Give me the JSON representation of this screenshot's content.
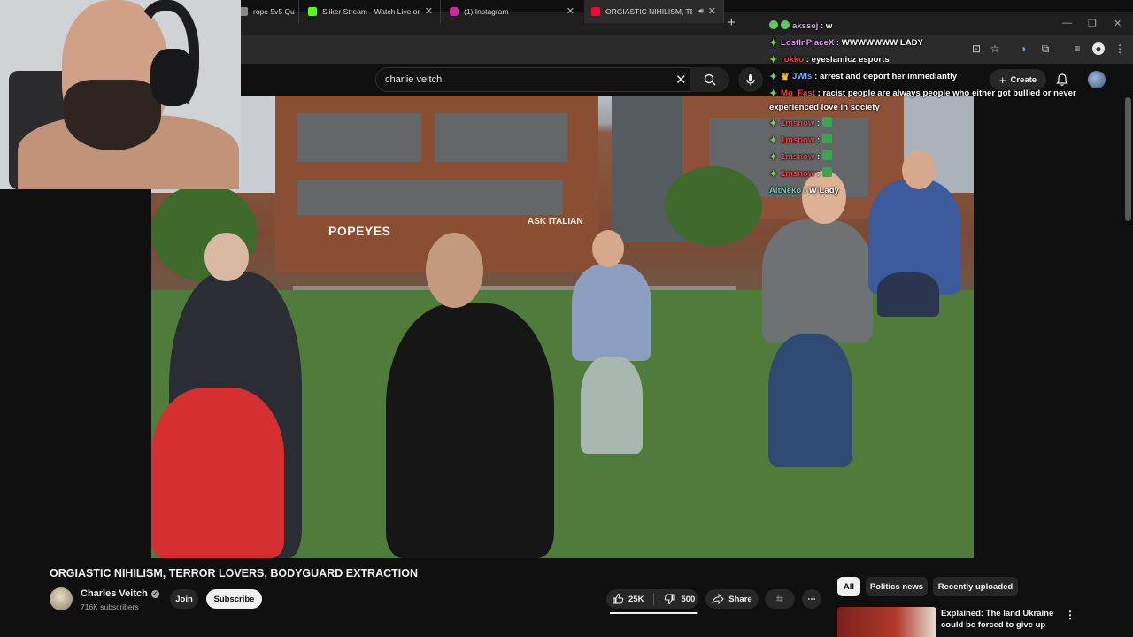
{
  "browser": {
    "tabs": [
      {
        "label": "rope 5v5 Qu",
        "icon": "generic-favicon",
        "color": "#888888"
      },
      {
        "label": "Sliker Stream - Watch Live on K",
        "icon": "kick-favicon",
        "color": "#53fc18"
      },
      {
        "label": "(1) Instagram",
        "icon": "instagram-favicon",
        "color": "#d6249f"
      },
      {
        "label": "ORGIASTIC NIHILISM, TERR",
        "icon": "youtube-favicon",
        "color": "#ff0033"
      }
    ]
  },
  "youtube": {
    "search_query": "charlie veitch",
    "create_label": "Create"
  },
  "chat": [
    {
      "user": "akssej",
      "user_color": "#d6a0e6",
      "message": "w",
      "badge": "circle"
    },
    {
      "user": "LostInPlaceX",
      "user_color": "#d6a0e6",
      "message": "WWWWWWW LADY",
      "badge": "sparkle"
    },
    {
      "user": "rokko",
      "user_color": "#ff3b3b",
      "message": "eyeslamicz esports",
      "badge": "sparkle"
    },
    {
      "user": "JWls",
      "user_color": "#7aa7ff",
      "message": "arrest and deport her immediantly",
      "badge": "crown"
    },
    {
      "user": "Mo_Fast",
      "user_color": "#ff3b3b",
      "message": "racist people are always people who either got bullied or never experienced love in society",
      "badge": "sparkle"
    },
    {
      "user": "1msnow",
      "user_color": "#ff3b3b",
      "message": "",
      "badge": "sparkle",
      "emote": true
    },
    {
      "user": "1msnow",
      "user_color": "#ff3b3b",
      "message": "",
      "badge": "sparkle",
      "emote": true
    },
    {
      "user": "1msnow",
      "user_color": "#ff3b3b",
      "message": "",
      "badge": "sparkle",
      "emote": true
    },
    {
      "user": "1msnow",
      "user_color": "#ff3b3b",
      "message": "",
      "badge": "sparkle",
      "emote": true
    },
    {
      "user": "AltNeko",
      "user_color": "#5fd6b5",
      "message": "W Lady",
      "badge": "none"
    }
  ],
  "video": {
    "sign_text": "POPEYES",
    "sign_text2": "ASK ITALIAN"
  },
  "video_info": {
    "title": "ORGIASTIC NIHILISM, TERROR LOVERS, BODYGUARD EXTRACTION",
    "channel_name": "Charles Veitch",
    "subscribers": "716K subscribers",
    "join_label": "Join",
    "subscribe_label": "Subscribe",
    "likes": "25K",
    "dislikes": "500",
    "like_ratio": 0.98,
    "share_label": "Share"
  },
  "filter_chips": [
    {
      "label": "All",
      "active": true
    },
    {
      "label": "Politics news",
      "active": false
    },
    {
      "label": "Recently uploaded",
      "active": false
    }
  ],
  "recommendation": {
    "title": "Explained: The land Ukraine could be forced to give up"
  }
}
